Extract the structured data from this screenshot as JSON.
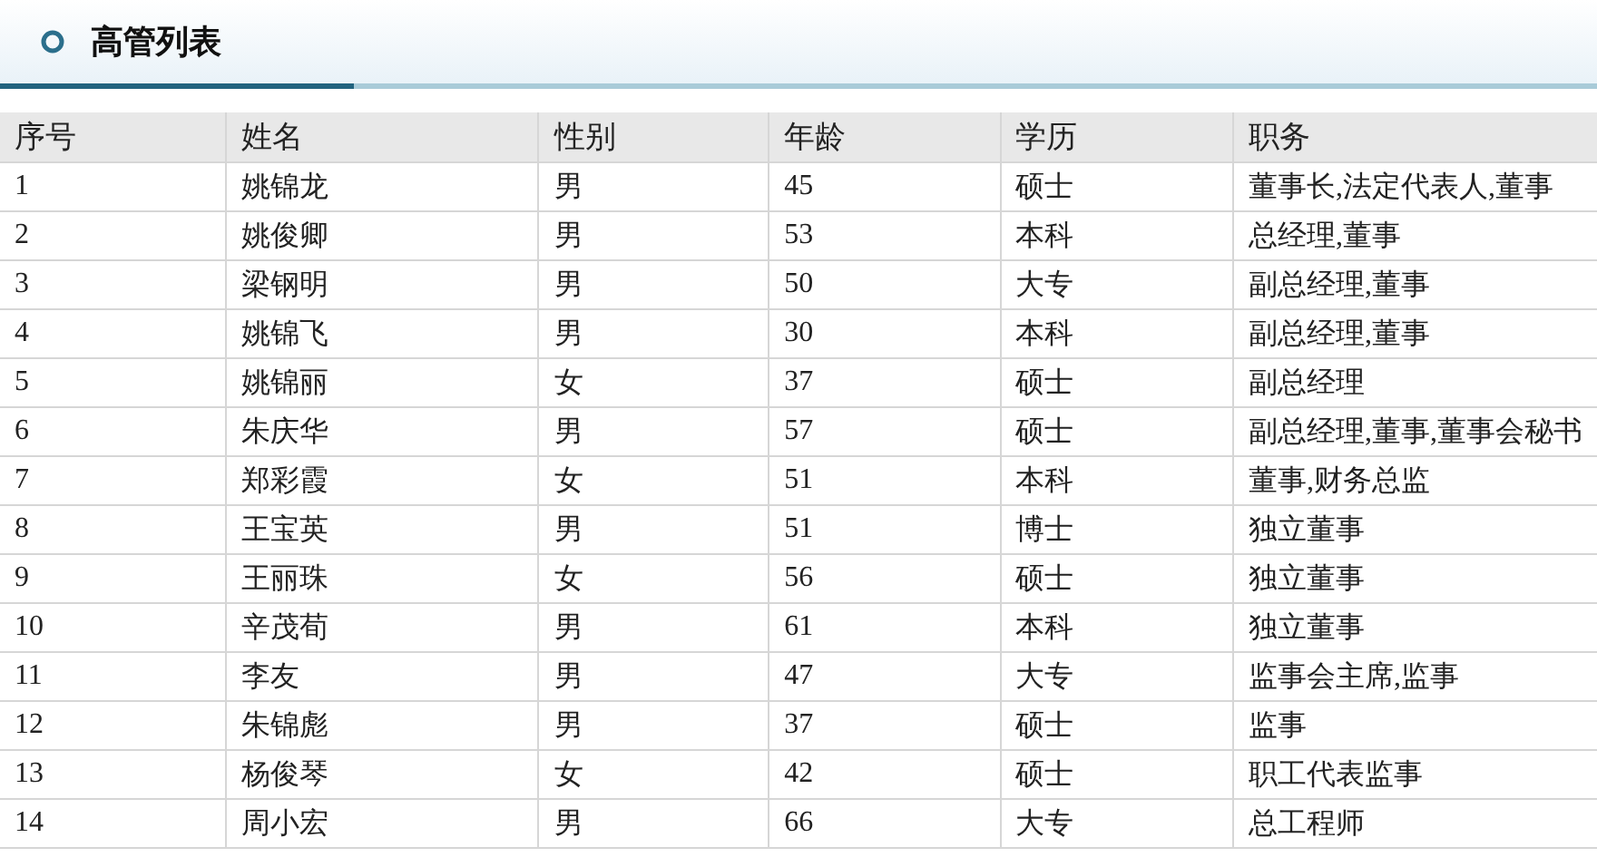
{
  "title": "高管列表",
  "table": {
    "columns": [
      "序号",
      "姓名",
      "性别",
      "年龄",
      "学历",
      "职务"
    ],
    "rows": [
      [
        "1",
        "姚锦龙",
        "男",
        "45",
        "硕士",
        "董事长,法定代表人,董事"
      ],
      [
        "2",
        "姚俊卿",
        "男",
        "53",
        "本科",
        "总经理,董事"
      ],
      [
        "3",
        "梁钢明",
        "男",
        "50",
        "大专",
        "副总经理,董事"
      ],
      [
        "4",
        "姚锦飞",
        "男",
        "30",
        "本科",
        "副总经理,董事"
      ],
      [
        "5",
        "姚锦丽",
        "女",
        "37",
        "硕士",
        "副总经理"
      ],
      [
        "6",
        "朱庆华",
        "男",
        "57",
        "硕士",
        "副总经理,董事,董事会秘书"
      ],
      [
        "7",
        "郑彩霞",
        "女",
        "51",
        "本科",
        "董事,财务总监"
      ],
      [
        "8",
        "王宝英",
        "男",
        "51",
        "博士",
        "独立董事"
      ],
      [
        "9",
        "王丽珠",
        "女",
        "56",
        "硕士",
        "独立董事"
      ],
      [
        "10",
        "辛茂荀",
        "男",
        "61",
        "本科",
        "独立董事"
      ],
      [
        "11",
        "李友",
        "男",
        "47",
        "大专",
        "监事会主席,监事"
      ],
      [
        "12",
        "朱锦彪",
        "男",
        "37",
        "硕士",
        "监事"
      ],
      [
        "13",
        "杨俊琴",
        "女",
        "42",
        "硕士",
        "职工代表监事"
      ],
      [
        "14",
        "周小宏",
        "男",
        "66",
        "大专",
        "总工程师"
      ]
    ]
  }
}
